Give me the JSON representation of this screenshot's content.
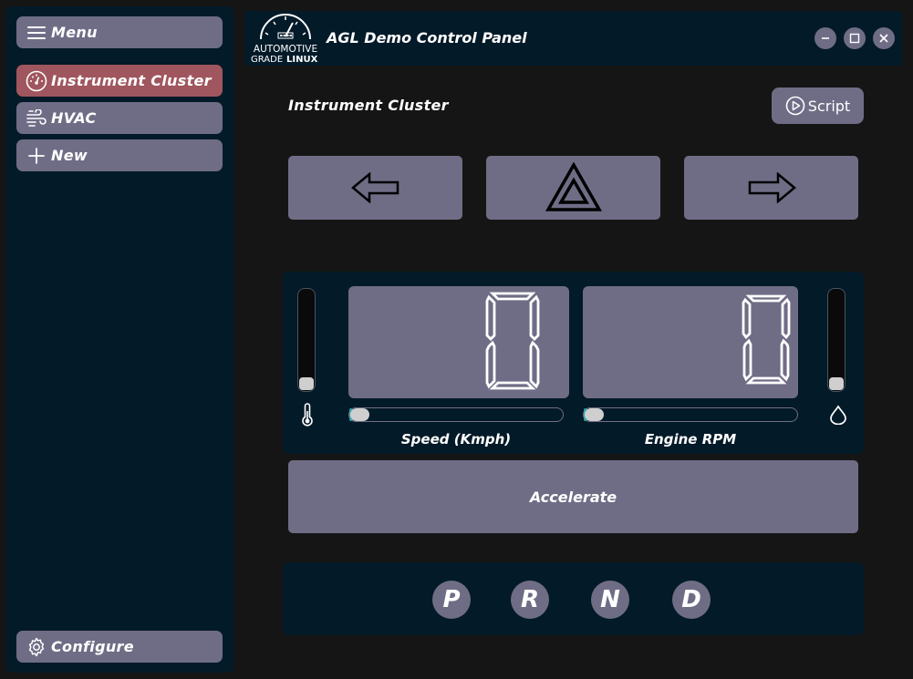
{
  "sidebar": {
    "menu_label": "Menu",
    "items": [
      {
        "label": "Instrument Cluster",
        "icon": "speedometer-icon",
        "active": true
      },
      {
        "label": "HVAC",
        "icon": "wind-icon",
        "active": false
      },
      {
        "label": "New",
        "icon": "plus-icon",
        "active": false
      }
    ],
    "configure_label": "Configure"
  },
  "header": {
    "title": "AGL Demo Control Panel",
    "logo_line1": "AUTOMOTIVE",
    "logo_line2_a": "GRADE",
    "logo_line2_b": "LINUX",
    "window_controls": [
      "minimize-icon",
      "maximize-icon",
      "close-icon"
    ]
  },
  "page": {
    "title": "Instrument Cluster",
    "script_label": "Script"
  },
  "signals": [
    "left-arrow-icon",
    "hazard-icon",
    "right-arrow-icon"
  ],
  "cluster": {
    "speed_value": "0",
    "rpm_value": "0",
    "speed_label": "Speed (Kmph)",
    "rpm_label": "Engine RPM",
    "speed_slider": 0,
    "rpm_slider": 0,
    "temperature_level": 0,
    "fuel_level": 0,
    "left_gauge_icon": "thermometer-icon",
    "right_gauge_icon": "droplet-icon"
  },
  "accelerate_label": "Accelerate",
  "gears": [
    "P",
    "R",
    "N",
    "D"
  ],
  "colors": {
    "background": "#151515",
    "panel": "#031a28",
    "button": "#6f6d86",
    "active": "#a0565e",
    "slider_fill": "#36a0a8"
  }
}
